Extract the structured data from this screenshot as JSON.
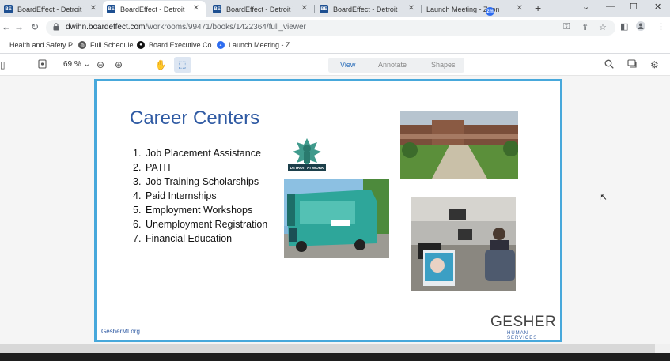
{
  "tabs": [
    {
      "label": "BoardEffect - Detroit Wa",
      "favicon": "BE"
    },
    {
      "label": "BoardEffect - Detroit Wa",
      "favicon": "BE",
      "active": true
    },
    {
      "label": "BoardEffect - Detroit Wa",
      "favicon": "BE"
    },
    {
      "label": "BoardEffect - Detroit Wa",
      "favicon": "BE"
    },
    {
      "label": "Launch Meeting - Zoom",
      "favicon": "zm"
    }
  ],
  "address": {
    "host": "dwihn.boardeffect.com",
    "path": "/workrooms/99471/books/1422364/full_viewer"
  },
  "bookmarks": [
    {
      "label": "Health and Safety P..."
    },
    {
      "label": "Full Schedule"
    },
    {
      "label": "Board Executive Co..."
    },
    {
      "label": "Launch Meeting - Z..."
    }
  ],
  "viewer": {
    "zoom": "69 %",
    "modes": [
      "View",
      "Annotate",
      "Shapes"
    ],
    "active_mode": "View"
  },
  "slide": {
    "title": "Career Centers",
    "items": [
      {
        "num": "1.",
        "text": "Job Placement Assistance"
      },
      {
        "num": "2.",
        "text": "PATH"
      },
      {
        "num": "3.",
        "text": "Job Training Scholarships"
      },
      {
        "num": "4.",
        "text": "Paid Internships"
      },
      {
        "num": "5.",
        "text": "Employment Workshops"
      },
      {
        "num": "6.",
        "text": "Unemployment Registration"
      },
      {
        "num": "7.",
        "text": "Financial Education"
      }
    ],
    "logo_text": "DETROIT AT WORK",
    "footer_url": "GesherMI.org",
    "brand": "GESHER",
    "brand_sub": "HUMAN SERVICES"
  },
  "colors": {
    "accent": "#2f5aa3",
    "slide_border": "#47a8db",
    "tab_favicon": "#1d4f91"
  }
}
